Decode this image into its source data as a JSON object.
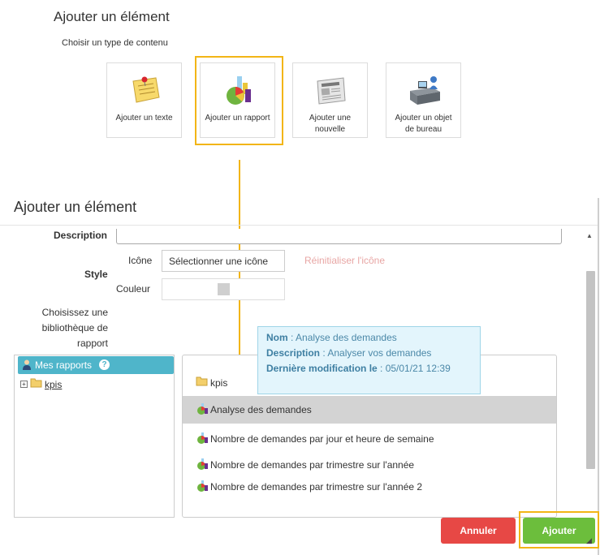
{
  "top_panel": {
    "title": "Ajouter un élément",
    "subtitle": "Choisir un type de contenu",
    "cards": [
      {
        "label": "Ajouter un texte",
        "icon": "sticky-note-icon"
      },
      {
        "label": "Ajouter un rapport",
        "icon": "report-chart-icon"
      },
      {
        "label": "Ajouter une nouvelle",
        "icon": "newspaper-icon"
      },
      {
        "label": "Ajouter un objet de bureau",
        "icon": "office-desk-icon"
      }
    ],
    "selected_card": "Ajouter un rapport"
  },
  "dialog": {
    "title": "Ajouter un élément",
    "description_label": "Description",
    "description_value": "",
    "style_label": "Style",
    "icon_label": "Icône",
    "select_icon_button": "Sélectionner une icône",
    "reset_icon_link": "Réinitialiser l'icône",
    "color_label": "Couleur",
    "color_value": "#cfcfcf",
    "library_label": "Choisissez une bibliothèque de rapport",
    "tree": {
      "header": "Mes rapports",
      "help_glyph": "?",
      "toggle_glyph": "+",
      "items": [
        {
          "label": "kpis"
        }
      ]
    },
    "list": [
      {
        "label": "kpis",
        "type": "folder"
      },
      {
        "label": "Analyse des demandes",
        "type": "report",
        "selected": true
      },
      {
        "label": "Nombre de demandes par jour et heure de semaine",
        "type": "report"
      },
      {
        "label": "Nombre de demandes par trimestre sur l'année",
        "type": "report"
      },
      {
        "label": "Nombre de demandes par trimestre sur l'année 2",
        "type": "report"
      }
    ],
    "tooltip": {
      "name_key": "Nom",
      "name_value": " : Analyse des demandes",
      "desc_key": "Description",
      "desc_value": " : Analyser vos demandes",
      "modified_key": "Dernière modification le",
      "modified_value": " : 05/01/21 12:39"
    },
    "buttons": {
      "cancel": "Annuler",
      "add": "Ajouter"
    },
    "colors": {
      "cancel": "#e74845",
      "add": "#6cbe3c",
      "highlight": "#f2b516",
      "tree_header": "#4fb5ca"
    }
  }
}
